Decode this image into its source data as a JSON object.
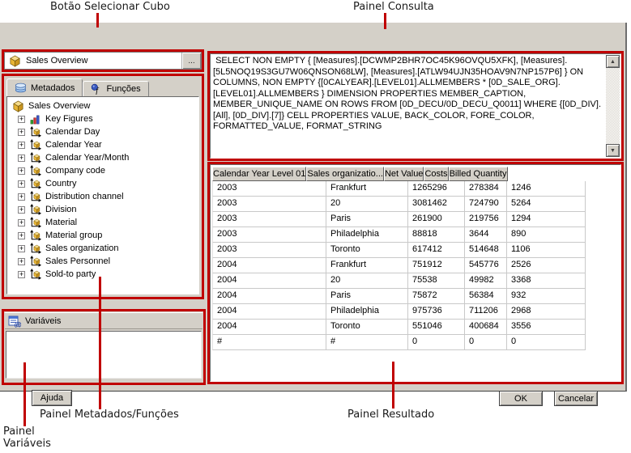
{
  "annotation_color": "#c00000",
  "annotations": {
    "cube_button": "Botão Selecionar Cubo",
    "query_panel": "Painel Consulta",
    "metadata_panel": "Painel Metadados/Funções",
    "result_panel": "Painel Resultado",
    "variables_panel_line1": "Painel",
    "variables_panel_line2": "Variáveis"
  },
  "cube_selector": {
    "value": "Sales Overview",
    "browse_button": "..."
  },
  "tabs": [
    {
      "label": "Metadados"
    },
    {
      "label": "Funções"
    }
  ],
  "metadata_tree": {
    "expander_glyph": "+",
    "root": {
      "label": "Sales Overview",
      "icon": "cube-icon"
    },
    "items": [
      {
        "label": "Key Figures",
        "icon": "key-figures-icon"
      },
      {
        "label": "Calendar Day",
        "icon": "dimension-icon"
      },
      {
        "label": "Calendar Year",
        "icon": "dimension-icon"
      },
      {
        "label": "Calendar Year/Month",
        "icon": "dimension-icon"
      },
      {
        "label": "Company code",
        "icon": "dimension-icon"
      },
      {
        "label": "Country",
        "icon": "dimension-icon"
      },
      {
        "label": "Distribution channel",
        "icon": "dimension-icon"
      },
      {
        "label": "Division",
        "icon": "dimension-icon"
      },
      {
        "label": "Material",
        "icon": "dimension-icon"
      },
      {
        "label": "Material group",
        "icon": "dimension-icon"
      },
      {
        "label": "Sales organization",
        "icon": "dimension-icon"
      },
      {
        "label": "Sales Personnel",
        "icon": "dimension-icon"
      },
      {
        "label": "Sold-to party",
        "icon": "dimension-icon"
      }
    ]
  },
  "query_panel": {
    "text": " SELECT NON EMPTY { [Measures].[DCWMP2BHR7OC45K96OVQU5XFK], [Measures].[5L5NOQ19S3GU7W06QNSON68LW], [Measures].[ATLW94UJN35HOAV9N7NP157P6] } ON COLUMNS, NON EMPTY {[0CALYEAR].[LEVEL01].ALLMEMBERS * [0D_SALE_ORG].[LEVEL01].ALLMEMBERS } DIMENSION PROPERTIES MEMBER_CAPTION, MEMBER_UNIQUE_NAME ON ROWS FROM [0D_DECU/0D_DECU_Q0011] WHERE {[0D_DIV].[All], [0D_DIV].[7]} CELL PROPERTIES VALUE, BACK_COLOR, FORE_COLOR, FORMATTED_VALUE, FORMAT_STRING"
  },
  "scrollbar": {
    "up_glyph": "▲",
    "down_glyph": "▼"
  },
  "result_table": {
    "columns": [
      "Calendar Year Level 01",
      "Sales organizatio...",
      "Net Value",
      "Costs",
      "Billed Quantity"
    ],
    "rows": [
      [
        "2003",
        "Frankfurt",
        "1265296",
        "278384",
        "1246"
      ],
      [
        "2003",
        "20",
        "3081462",
        "724790",
        "5264"
      ],
      [
        "2003",
        "Paris",
        "261900",
        "219756",
        "1294"
      ],
      [
        "2003",
        "Philadelphia",
        "88818",
        "3644",
        "890"
      ],
      [
        "2003",
        "Toronto",
        "617412",
        "514648",
        "1106"
      ],
      [
        "2004",
        "Frankfurt",
        "751912",
        "545776",
        "2526"
      ],
      [
        "2004",
        "20",
        "75538",
        "49982",
        "3368"
      ],
      [
        "2004",
        "Paris",
        "75872",
        "56384",
        "932"
      ],
      [
        "2004",
        "Philadelphia",
        "975736",
        "711206",
        "2968"
      ],
      [
        "2004",
        "Toronto",
        "551046",
        "400684",
        "3556"
      ],
      [
        "#",
        "#",
        "0",
        "0",
        "0"
      ]
    ]
  },
  "variables_panel": {
    "title": "Variáveis"
  },
  "buttons": {
    "help": "Ajuda",
    "ok": "OK",
    "cancel": "Cancelar"
  }
}
